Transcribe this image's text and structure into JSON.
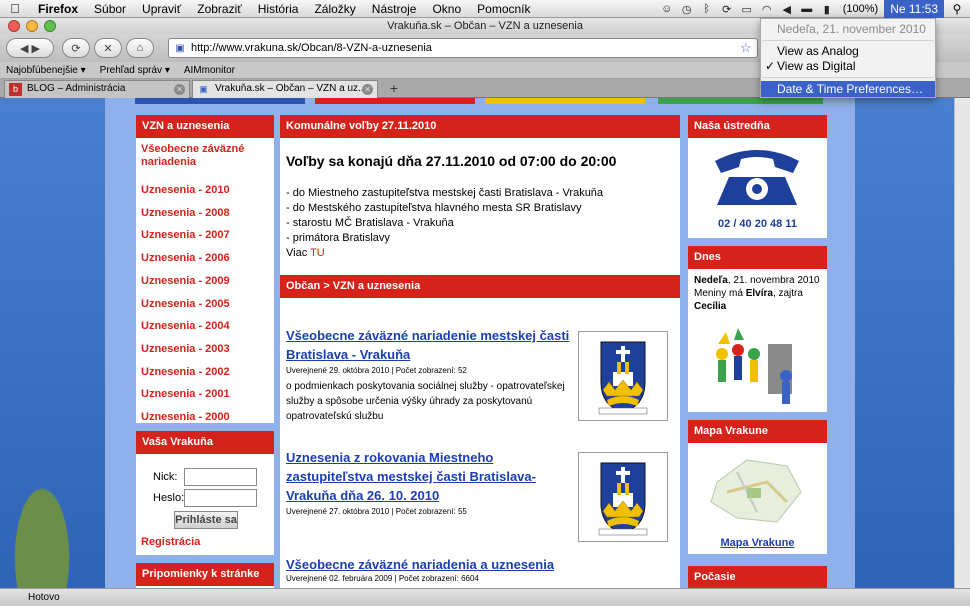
{
  "menubar": {
    "app": "Firefox",
    "items": [
      "Súbor",
      "Upraviť",
      "Zobraziť",
      "História",
      "Záložky",
      "Nástroje",
      "Okno",
      "Pomocník"
    ],
    "battery": "(100%)",
    "clock": "Ne 11:53"
  },
  "window": {
    "title": "Vrakuňa.sk – Občan – VZN a uznesenia"
  },
  "toolbar": {
    "url": "http://www.vrakuna.sk/Obcan/8-VZN-a-uznesenia"
  },
  "bookmarks": [
    "Najobľúbenejšie ▾",
    "Prehľad správ ▾",
    "AIMmonitor"
  ],
  "tabs": [
    {
      "label": "BLOG – Administrácia"
    },
    {
      "label": "Vrakuňa.sk – Občan – VZN a uz..."
    }
  ],
  "dropdown": {
    "date": "Nedeľa, 21. november 2010",
    "analog": "View as Analog",
    "digital": "View as Digital",
    "check": "✓",
    "prefs": "Date & Time Preferences…"
  },
  "left": {
    "vzn_header": "VZN a uznesenia",
    "links": [
      "Všeobecne záväzné nariadenia",
      "Uznesenia - 2010",
      "Uznesenia - 2008",
      "Uznesenia - 2007",
      "Uznesenia - 2006",
      "Uznesenia - 2009",
      "Uznesenia - 2005",
      "Uznesenia - 2004",
      "Uznesenia - 2003",
      "Uznesenia - 2002",
      "Uznesenia - 2001",
      "Uznesenia - 2000"
    ],
    "vasa_header": "Vaša Vrakuňa",
    "nick_label": "Nick:",
    "heslo_label": "Heslo:",
    "login_button": "Prihláste sa",
    "register": "Registrácia",
    "pripomienky_header": "Pripomienky k stránke"
  },
  "center": {
    "elections_header": "Komunálne voľby 27.11.2010",
    "elections_title": "Voľby sa konajú dňa 27.11.2010 od 07:00 do 20:00",
    "elections_lines": [
      "- do Miestneho zastupiteľstva mestskej časti Bratislava - Vrakuňa",
      "- do Mestského zastupiteľstva hlavného mesta SR Bratislavy",
      "- starostu MČ Bratislava - Vrakuňa",
      "- primátora Bratislavy"
    ],
    "more_prefix": "Viac ",
    "more_link": "TU",
    "breadcrumb": "Občan > VZN a uznesenia",
    "articles": [
      {
        "title": "Všeobecne záväzné nariadenie mestskej časti Bratislava - Vrakuňa",
        "meta": "Uverejnené 29. októbra 2010 | Počet zobrazení: 52",
        "body": "o podmienkach poskytovania sociálnej služby - opatrovateľskej služby a spôsobe určenia výšky úhrady za poskytovanú opatrovateľskú službu"
      },
      {
        "title": "Uznesenia z rokovania Miestneho zastupiteľstva mestskej časti Bratislava-Vrakuňa dňa 26. 10. 2010",
        "meta": "Uverejnené 27. októbra 2010 | Počet zobrazení: 55",
        "body": ""
      },
      {
        "title": "Všeobecne záväzné nariadenia a uznesenia",
        "meta": "Uverejnené 02. februára 2009 | Počet zobrazení: 6604",
        "body": ""
      }
    ]
  },
  "right": {
    "ustredna_header": "Naša ústredňa",
    "phone": "02 / 40 20 48 11",
    "dnes_header": "Dnes",
    "dnes_day": "Nedeľa",
    "dnes_date": ", 21. novembra 2010",
    "meniny_prefix": "Meniny má ",
    "meniny_name": "Elvíra",
    "meniny_mid": ", zajtra",
    "meniny_next": "Cecília",
    "mapa_header": "Mapa Vrakune",
    "mapa_link": "Mapa Vrakune",
    "pocasie_header": "Počasie"
  },
  "status": "Hotovo",
  "colors": {
    "accent_red": "#d5221a",
    "link_blue": "#1a3fb0",
    "selection_blue": "#3a62c7"
  }
}
